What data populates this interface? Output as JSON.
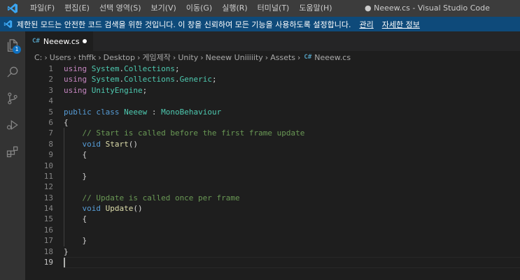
{
  "window": {
    "title": "● Neeew.cs - Visual Studio Code"
  },
  "menu": {
    "items": [
      "파일(F)",
      "편집(E)",
      "선택 영역(S)",
      "보기(V)",
      "이동(G)",
      "실행(R)",
      "터미널(T)",
      "도움말(H)"
    ]
  },
  "banner": {
    "text": "제한된 모드는 안전한 코드 검색을 위한 것입니다. 이 창을 신뢰하여 모든 기능을 사용하도록 설정합니다.",
    "manage_link": "관리",
    "details_link": "자세한 정보"
  },
  "activity": {
    "explorer_badge": "1"
  },
  "tab": {
    "lang": "C#",
    "name": "Neeew.cs"
  },
  "breadcrumb": {
    "items": [
      "C:",
      "Users",
      "thffk",
      "Desktop",
      "게임제작",
      "Unity",
      "Neeew Uniiiiity",
      "Assets"
    ],
    "file_lang": "C#",
    "file": "Neeew.cs"
  },
  "editor": {
    "line_numbers": [
      "1",
      "2",
      "3",
      "4",
      "5",
      "6",
      "7",
      "8",
      "9",
      "10",
      "11",
      "12",
      "13",
      "14",
      "15",
      "16",
      "17",
      "18",
      "19"
    ],
    "active_line": "19",
    "lines": {
      "l1": [
        "using",
        " ",
        "System",
        ".",
        "Collections",
        ";"
      ],
      "l2": [
        "using",
        " ",
        "System",
        ".",
        "Collections",
        ".",
        "Generic",
        ";"
      ],
      "l3": [
        "using",
        " ",
        "UnityEngine",
        ";"
      ],
      "l5": [
        "public",
        " ",
        "class",
        " ",
        "Neeew",
        " : ",
        "MonoBehaviour"
      ],
      "l6": "{",
      "l7": "    // Start is called before the first frame update",
      "l8": [
        "    ",
        "void",
        " ",
        "Start",
        "()"
      ],
      "l9": "    {",
      "l11": "    }",
      "l13": "    // Update is called once per frame",
      "l14": [
        "    ",
        "void",
        " ",
        "Update",
        "()"
      ],
      "l15": "    {",
      "l17": "    }",
      "l18": "}"
    }
  },
  "colors": {
    "accent": "#0e4a7a",
    "keyword": "#569cd6",
    "type": "#4ec9b0",
    "comment": "#6a9955",
    "function": "#dcdcaa"
  }
}
